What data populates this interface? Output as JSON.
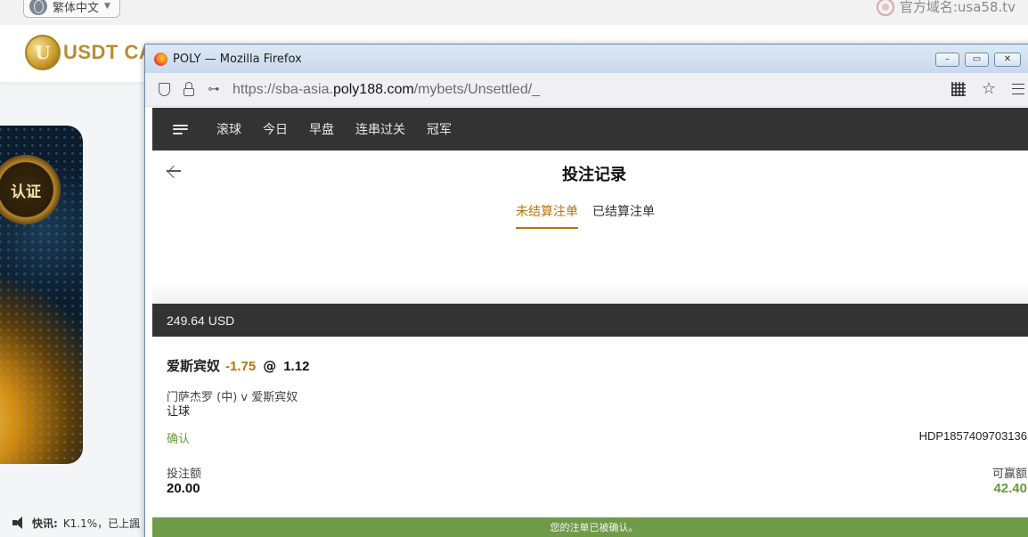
{
  "background_site": {
    "language_button": "繁体中文",
    "official_domain": "官方域名:usa58.tv",
    "brand_text": "USDT CA",
    "brand_coin_letter": "U",
    "banner_badge": "认证",
    "ticker_label": "快讯:",
    "ticker_text": "K1.1%，已上諷"
  },
  "window": {
    "title": "POLY — Mozilla Firefox",
    "controls": [
      "–",
      "▭",
      "✕"
    ],
    "url_prefix": "https://sba-asia.",
    "url_host": "poly188.com",
    "url_path": "/mybets/Unsettled/_"
  },
  "nav": {
    "items": [
      "滚球",
      "今日",
      "早盘",
      "连串过关",
      "冠军"
    ]
  },
  "page": {
    "title": "投注记录",
    "tabs": [
      {
        "label": "未结算注单",
        "active": true
      },
      {
        "label": "已结算注单",
        "active": false
      }
    ]
  },
  "balance": "249.64 USD",
  "bet": {
    "selection": "爱斯宾奴",
    "handicap": "-1.75",
    "at": "@",
    "odds": "1.12",
    "match": "门萨杰罗 (中) v 爱斯宾奴",
    "market": "让球",
    "status": "确认",
    "ticket_id": "HDP1857409703136",
    "stake_label": "投注额",
    "stake_value": "20.00",
    "win_label": "可赢额",
    "win_value": "42.40"
  },
  "confirmation": "您的注单已被确认。",
  "colors": {
    "accent": "#b8730b",
    "status_green": "#6a9a3f",
    "dark_bar": "#333333",
    "confirm_bar": "#6f9a48"
  }
}
